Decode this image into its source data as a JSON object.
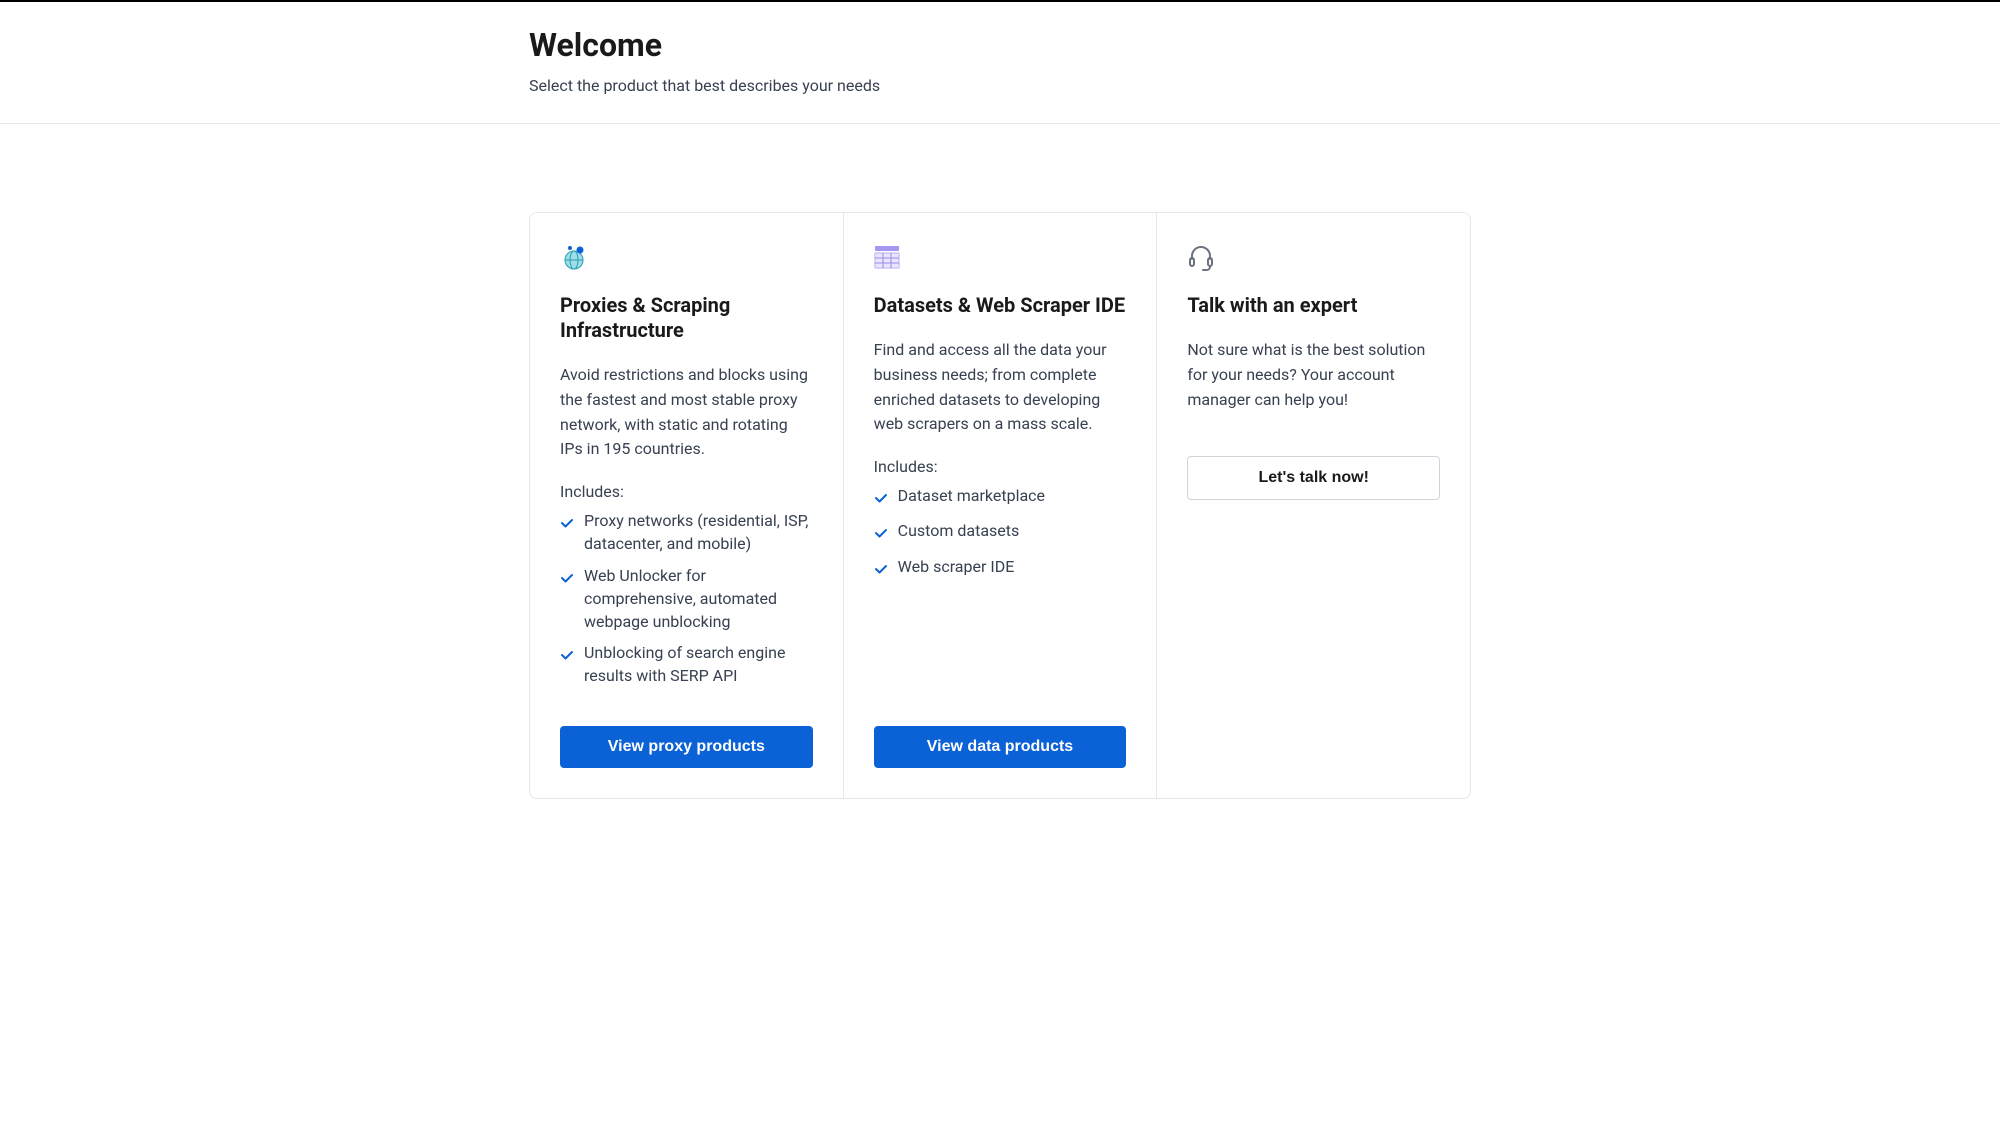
{
  "header": {
    "title": "Welcome",
    "subtitle": "Select the product that best describes your needs"
  },
  "cards": {
    "proxies": {
      "title": "Proxies & Scraping Infrastructure",
      "description": "Avoid restrictions and blocks using the fastest and most stable proxy network, with static and rotating IPs in 195 countries.",
      "includesLabel": "Includes:",
      "includes": [
        "Proxy networks (residential, ISP, datacenter, and mobile)",
        "Web Unlocker for comprehensive, automated webpage unblocking",
        "Unblocking of search engine results with SERP API"
      ],
      "buttonLabel": "View proxy products"
    },
    "datasets": {
      "title": "Datasets & Web Scraper IDE",
      "description": "Find and access all the data your business needs; from complete enriched datasets to developing web scrapers on a mass scale.",
      "includesLabel": "Includes:",
      "includes": [
        "Dataset marketplace",
        "Custom datasets",
        "Web scraper IDE"
      ],
      "buttonLabel": "View data products"
    },
    "expert": {
      "title": "Talk with an expert",
      "description": "Not sure what is the best solution for your needs? Your account manager can help you!",
      "buttonLabel": "Let's talk now!"
    }
  }
}
